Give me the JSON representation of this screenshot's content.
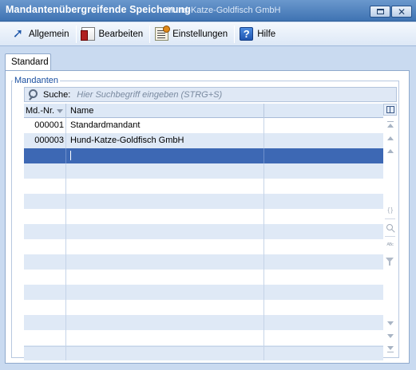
{
  "window": {
    "title": "Mandantenübergreifende Speicherung",
    "background_title": "Hund-Katze-Goldfisch GmbH"
  },
  "toolbar": {
    "items": [
      {
        "label": "Allgemein",
        "icon": "arrow-icon"
      },
      {
        "label": "Bearbeiten",
        "icon": "edit-icon"
      },
      {
        "label": "Einstellungen",
        "icon": "settings-icon"
      },
      {
        "label": "Hilfe",
        "icon": "help-icon"
      }
    ]
  },
  "tabs": [
    {
      "label": "Standard",
      "active": true
    }
  ],
  "group": {
    "label": "Mandanten"
  },
  "search": {
    "label": "Suche:",
    "placeholder": "Hier Suchbegriff eingeben (STRG+S)",
    "value": ""
  },
  "grid": {
    "columns": [
      "Md.-Nr.",
      "Name",
      ""
    ],
    "sort_column": "Md.-Nr.",
    "rows": [
      {
        "id": "000001",
        "name": "Standardmandant",
        "selected": false
      },
      {
        "id": "000003",
        "name": "Hund-Katze-Goldfisch GmbH",
        "selected": false
      },
      {
        "id": "",
        "name": "",
        "selected": true
      }
    ],
    "empty_rows": 13
  },
  "colors": {
    "title_bar": "#4a7fc0",
    "selection": "#3d68b4",
    "alt_row": "#dfe9f6",
    "group_label": "#1a4fa0"
  }
}
